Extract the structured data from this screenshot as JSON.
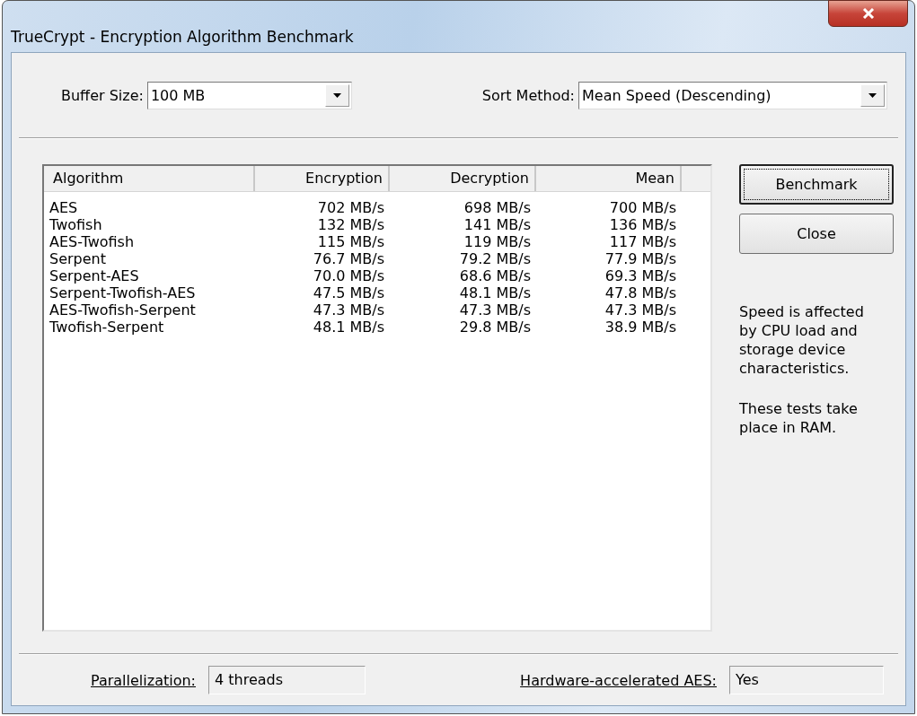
{
  "window": {
    "title": "TrueCrypt - Encryption Algorithm Benchmark"
  },
  "buffer_size": {
    "label": "Buffer Size:",
    "value": "100 MB"
  },
  "sort_method": {
    "label": "Sort Method:",
    "value": "Mean Speed (Descending)"
  },
  "table": {
    "columns": [
      "Algorithm",
      "Encryption",
      "Decryption",
      "Mean"
    ],
    "rows": [
      [
        "AES",
        "702 MB/s",
        "698 MB/s",
        "700 MB/s"
      ],
      [
        "Twofish",
        "132 MB/s",
        "141 MB/s",
        "136 MB/s"
      ],
      [
        "AES-Twofish",
        "115 MB/s",
        "119 MB/s",
        "117 MB/s"
      ],
      [
        "Serpent",
        "76.7 MB/s",
        "79.2 MB/s",
        "77.9 MB/s"
      ],
      [
        "Serpent-AES",
        "70.0 MB/s",
        "68.6 MB/s",
        "69.3 MB/s"
      ],
      [
        "Serpent-Twofish-AES",
        "47.5 MB/s",
        "48.1 MB/s",
        "47.8 MB/s"
      ],
      [
        "AES-Twofish-Serpent",
        "47.3 MB/s",
        "47.3 MB/s",
        "47.3 MB/s"
      ],
      [
        "Twofish-Serpent",
        "48.1 MB/s",
        "29.8 MB/s",
        "38.9 MB/s"
      ]
    ]
  },
  "buttons": [
    {
      "label": "Benchmark",
      "focused": true
    },
    {
      "label": "Close",
      "focused": false
    }
  ],
  "notes": [
    "Speed is affected by CPU load and storage device characteristics.",
    "These tests take place in RAM."
  ],
  "status": [
    {
      "label": "Parallelization:",
      "value": "4 threads"
    },
    {
      "label": "Hardware-accelerated AES:",
      "value": "Yes"
    }
  ]
}
